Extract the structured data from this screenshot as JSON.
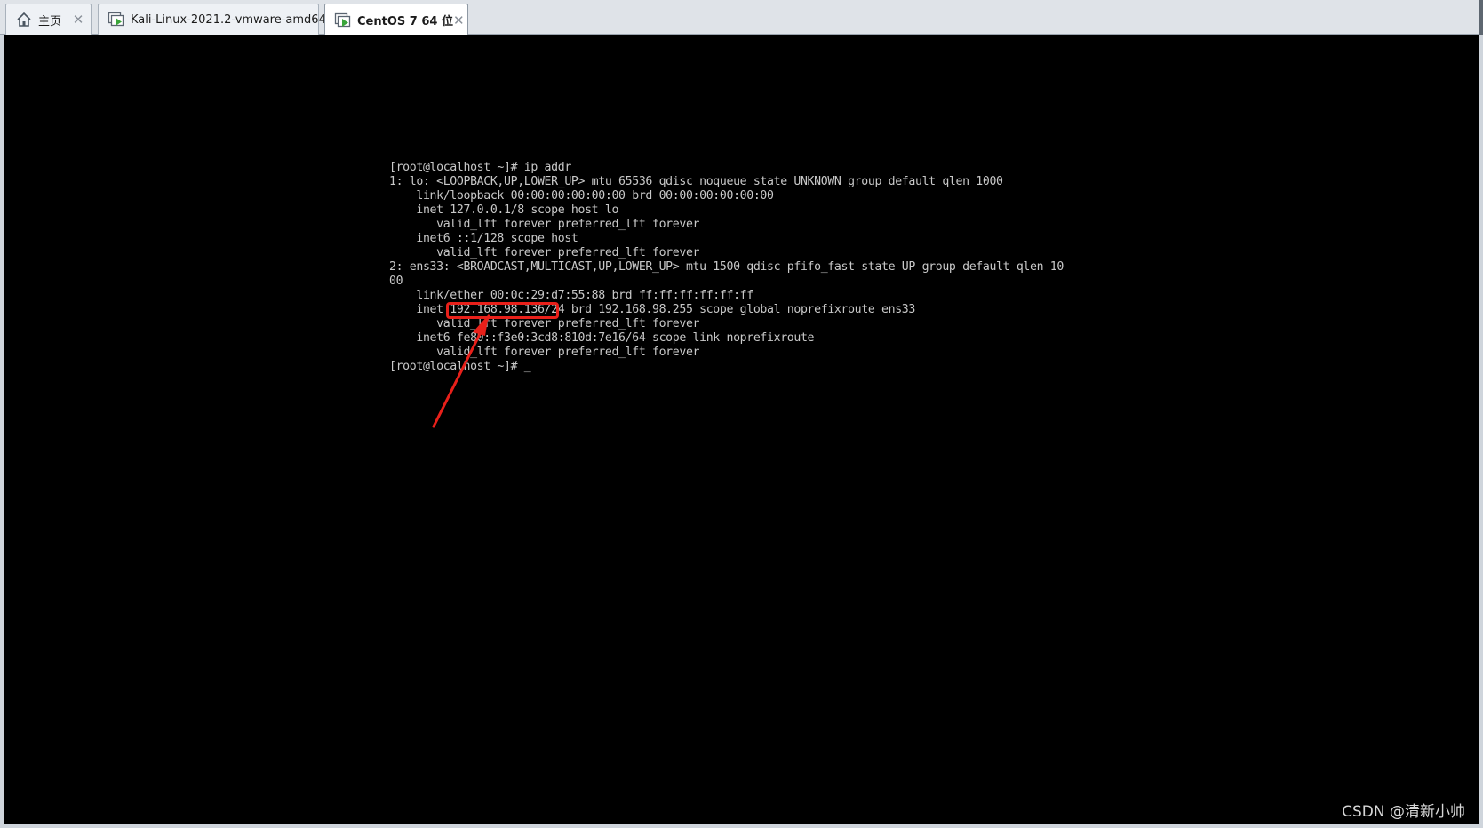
{
  "tabs": [
    {
      "label": "主页",
      "icon": "home-icon",
      "active": false
    },
    {
      "label": "Kali-Linux-2021.2-vmware-amd64",
      "icon": "vm-running-icon",
      "active": false
    },
    {
      "label": "CentOS 7 64 位",
      "icon": "vm-running-icon",
      "active": true
    }
  ],
  "terminal": {
    "lines": [
      "[root@localhost ~]# ip addr",
      "1: lo: <LOOPBACK,UP,LOWER_UP> mtu 65536 qdisc noqueue state UNKNOWN group default qlen 1000",
      "    link/loopback 00:00:00:00:00:00 brd 00:00:00:00:00:00",
      "    inet 127.0.0.1/8 scope host lo",
      "       valid_lft forever preferred_lft forever",
      "    inet6 ::1/128 scope host",
      "       valid_lft forever preferred_lft forever",
      "2: ens33: <BROADCAST,MULTICAST,UP,LOWER_UP> mtu 1500 qdisc pfifo_fast state UP group default qlen 10",
      "00",
      "    link/ether 00:0c:29:d7:55:88 brd ff:ff:ff:ff:ff:ff",
      "    inet 192.168.98.136/24 brd 192.168.98.255 scope global noprefixroute ens33",
      "       valid_lft forever preferred_lft forever",
      "    inet6 fe80::f3e0:3cd8:810d:7e16/64 scope link noprefixroute",
      "       valid_lft forever preferred_lft forever",
      "[root@localhost ~]# _"
    ]
  },
  "annotation": {
    "highlighted_text": "192.168.98.136",
    "color": "#e8201a"
  },
  "watermark": "CSDN @清新小帅",
  "colors": {
    "console_bg": "#000000",
    "console_text": "#c8c8c8",
    "tabbar_bg": "#dfe3e8",
    "vm_icon_green": "#3aa53a"
  }
}
